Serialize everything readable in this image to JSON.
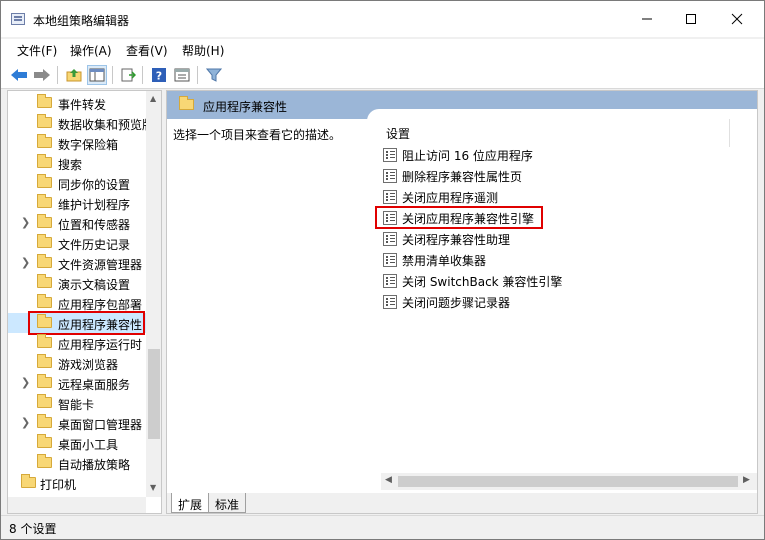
{
  "window": {
    "title": "本地组策略编辑器"
  },
  "menu": [
    "文件(F)",
    "操作(A)",
    "查看(V)",
    "帮助(H)"
  ],
  "toolbar": {
    "buttons": [
      "back-icon",
      "forward-icon",
      "up-folder-icon",
      "show-hide-tree-icon",
      "export-list-icon",
      "help-icon",
      "properties-icon",
      "filter-icon"
    ]
  },
  "tree": {
    "items": [
      {
        "label": "事件转发",
        "expandable": false
      },
      {
        "label": "数据收集和预览版",
        "expandable": false
      },
      {
        "label": "数字保险箱",
        "expandable": false
      },
      {
        "label": "搜索",
        "expandable": false
      },
      {
        "label": "同步你的设置",
        "expandable": false
      },
      {
        "label": "维护计划程序",
        "expandable": false
      },
      {
        "label": "位置和传感器",
        "expandable": true
      },
      {
        "label": "文件历史记录",
        "expandable": false
      },
      {
        "label": "文件资源管理器",
        "expandable": true
      },
      {
        "label": "演示文稿设置",
        "expandable": false
      },
      {
        "label": "应用程序包部署",
        "expandable": false
      },
      {
        "label": "应用程序兼容性",
        "expandable": false,
        "selected": true
      },
      {
        "label": "应用程序运行时",
        "expandable": false
      },
      {
        "label": "游戏浏览器",
        "expandable": false
      },
      {
        "label": "远程桌面服务",
        "expandable": true
      },
      {
        "label": "智能卡",
        "expandable": false
      },
      {
        "label": "桌面窗口管理器",
        "expandable": true
      },
      {
        "label": "桌面小工具",
        "expandable": false
      },
      {
        "label": "自动播放策略",
        "expandable": false
      }
    ],
    "root_item": "打印机"
  },
  "main": {
    "header_title": "应用程序兼容性",
    "description": "选择一个项目来查看它的描述。",
    "column_header": "设置",
    "settings": [
      {
        "label": "阻止访问 16 位应用程序"
      },
      {
        "label": "删除程序兼容性属性页"
      },
      {
        "label": "关闭应用程序遥测"
      },
      {
        "label": "关闭应用程序兼容性引擎",
        "highlighted": true
      },
      {
        "label": "关闭程序兼容性助理"
      },
      {
        "label": "禁用清单收集器"
      },
      {
        "label": "关闭 SwitchBack 兼容性引擎"
      },
      {
        "label": "关闭问题步骤记录器"
      }
    ],
    "tabs": [
      "扩展",
      "标准"
    ]
  },
  "status": {
    "text": "8 个设置"
  },
  "colors": {
    "header_bg": "#9bb6d7",
    "selection_bg": "#cce8ff",
    "highlight_border": "#e00000"
  }
}
